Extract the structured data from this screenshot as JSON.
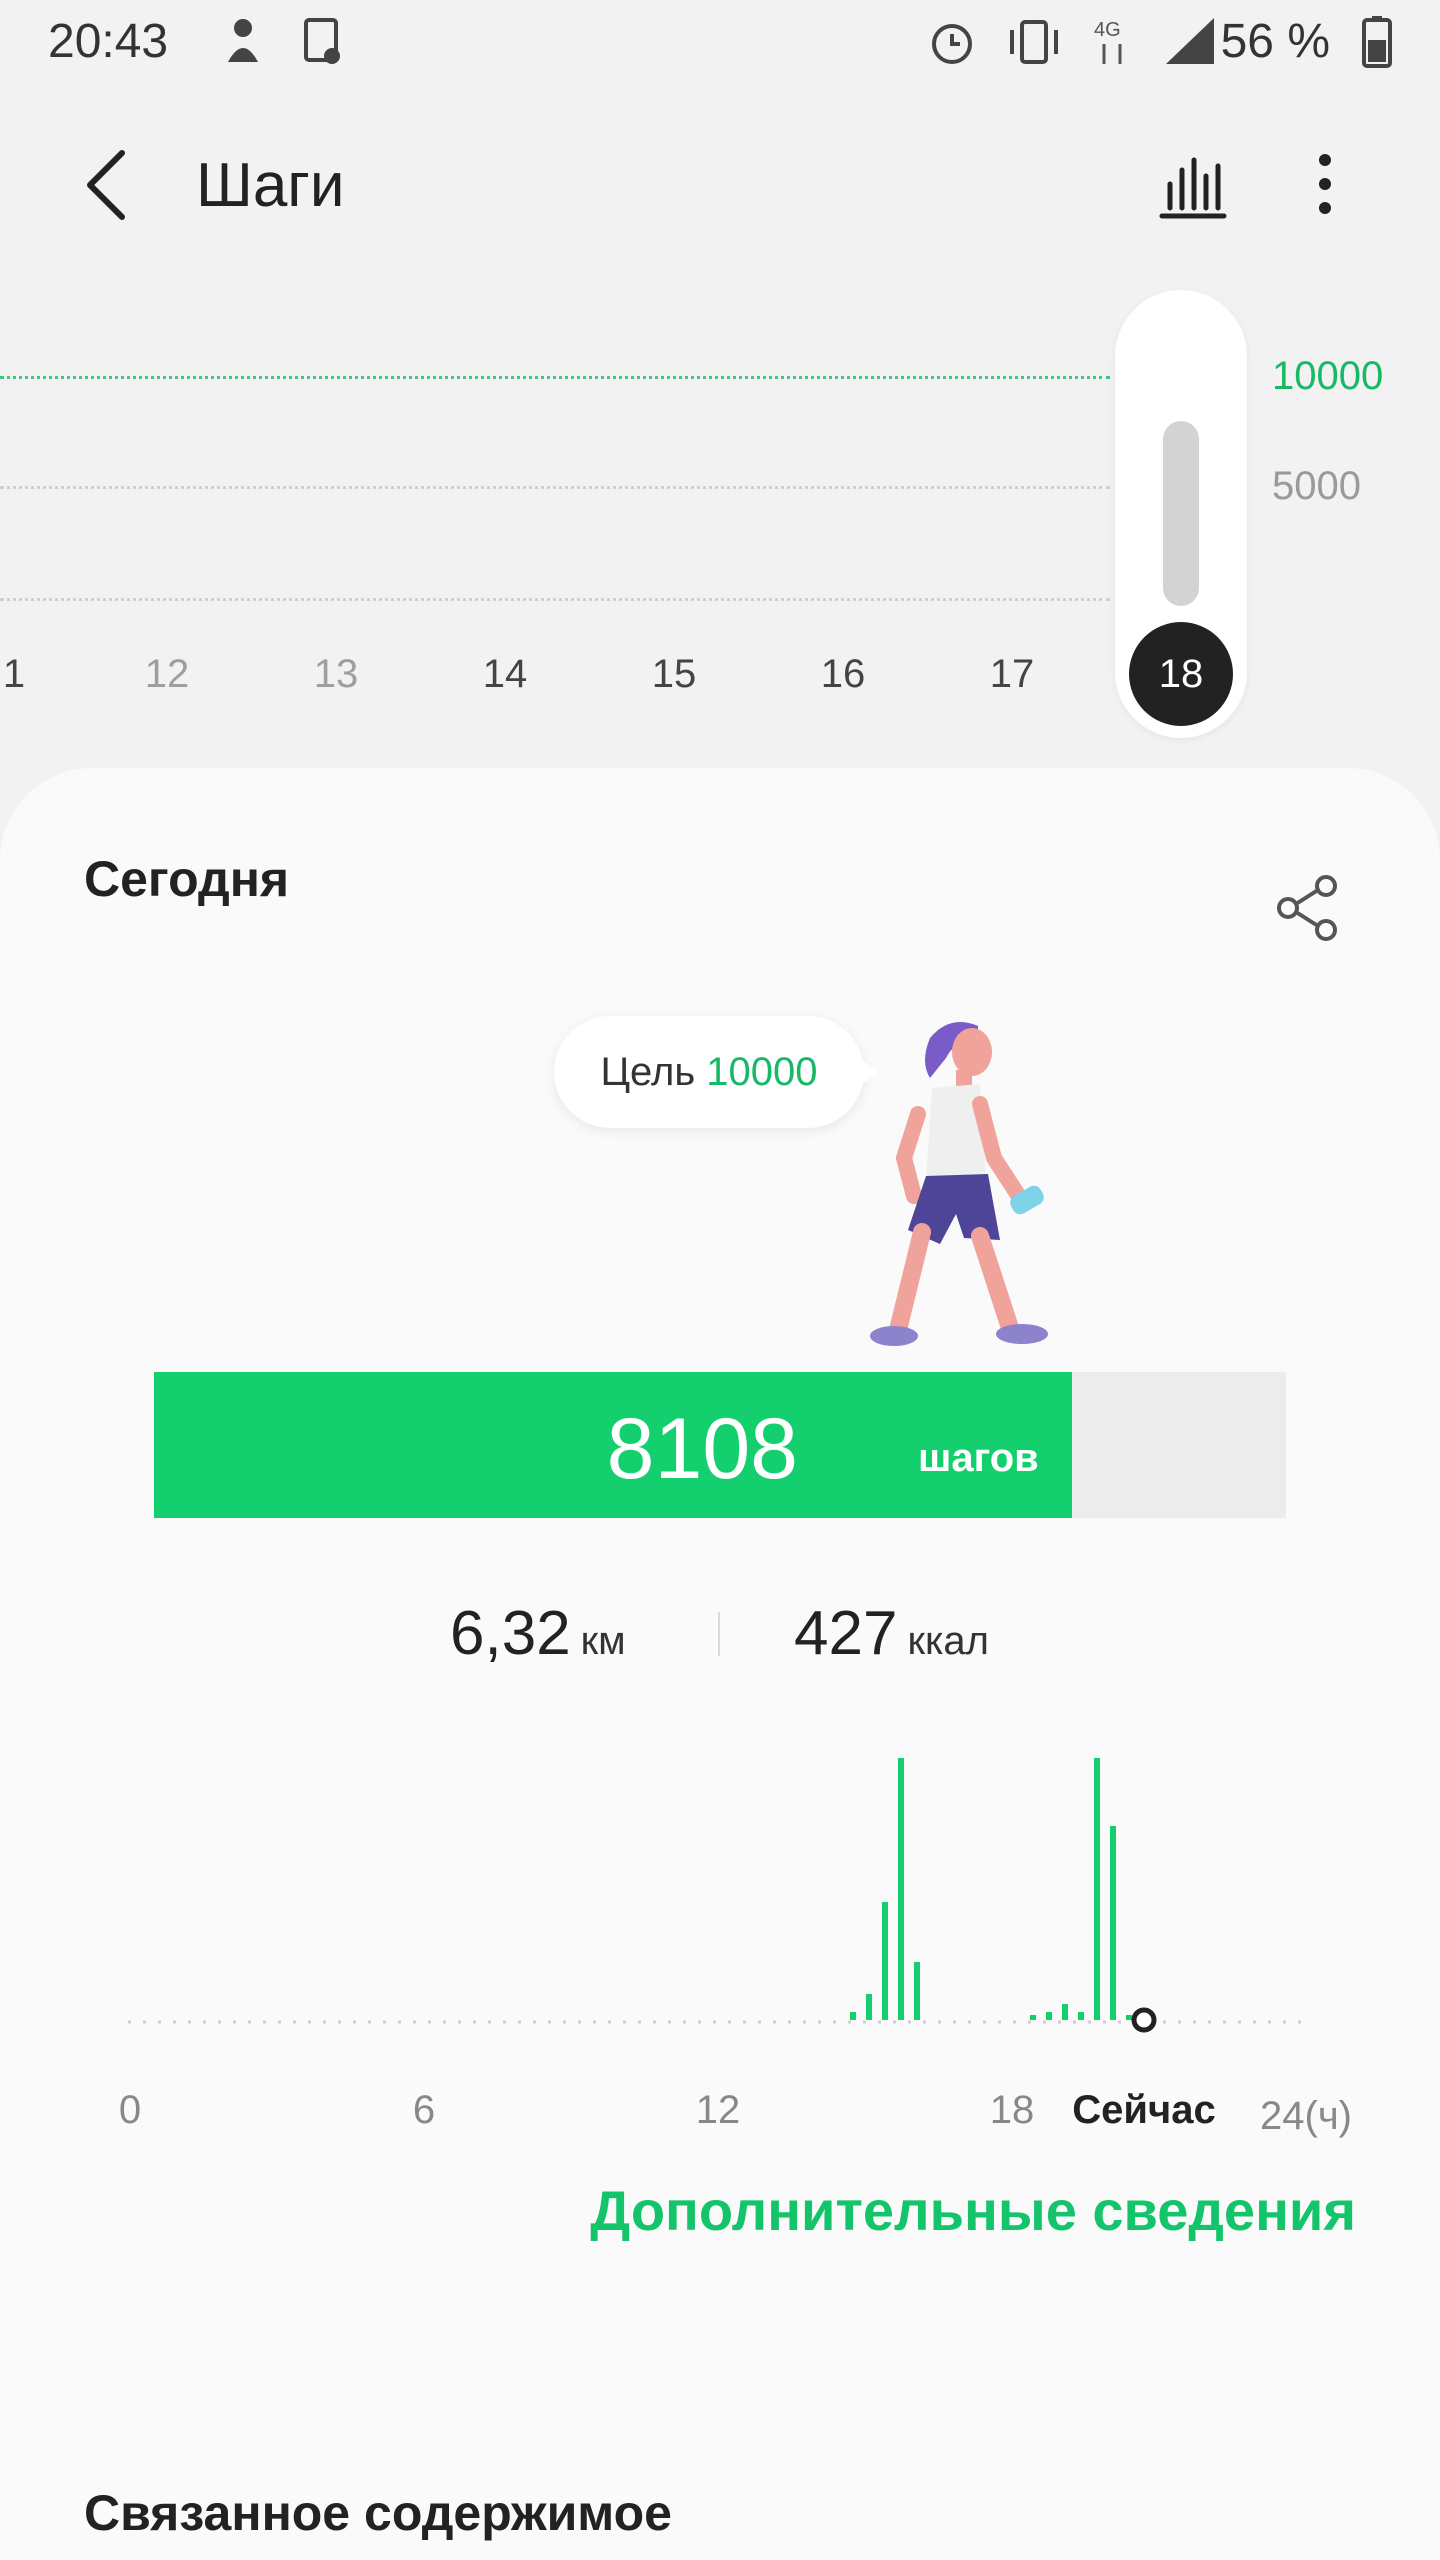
{
  "status_bar": {
    "time": "20:43",
    "battery_text": "56 %",
    "icons": [
      "notification-icon",
      "sim-settings-icon",
      "alarm-icon",
      "vibrate-icon",
      "4g-icon",
      "signal-icon",
      "battery-icon"
    ]
  },
  "app_bar": {
    "title": "Шаги",
    "back_icon": "back-arrow-icon",
    "chart_icon": "bar-chart-icon",
    "menu_icon": "more-vert-icon"
  },
  "day_strip": {
    "goal_label": "10000",
    "mid_label": "5000",
    "days": [
      "1",
      "12",
      "13",
      "14",
      "15",
      "16",
      "17"
    ],
    "selected_day": "18",
    "selected_day_level": 0.37
  },
  "today": {
    "title": "Сегодня",
    "share_icon": "share-icon",
    "goal_prefix": "Цель",
    "goal_value": "10000",
    "steps": "8108",
    "steps_unit": "шагов",
    "progress_fraction": 0.8108,
    "distance_value": "6,32",
    "distance_unit": "км",
    "calories_value": "427",
    "calories_unit": "ккал"
  },
  "hourly_chart": {
    "x_labels": [
      "0",
      "6",
      "12",
      "18",
      "Сейчас",
      "24(ч)"
    ],
    "bars_relative": [
      0.03,
      0.1,
      0.45,
      1.0,
      0.22,
      0.02,
      0.03,
      0.06,
      0.03,
      1.0,
      0.74,
      0.02
    ]
  },
  "more_info_label": "Дополнительные сведения",
  "related_title": "Связанное содержимое",
  "colors": {
    "accent": "#14cf6e",
    "accent_text": "#19b866",
    "background": "#f2f2f2",
    "card": "#fafafa"
  }
}
